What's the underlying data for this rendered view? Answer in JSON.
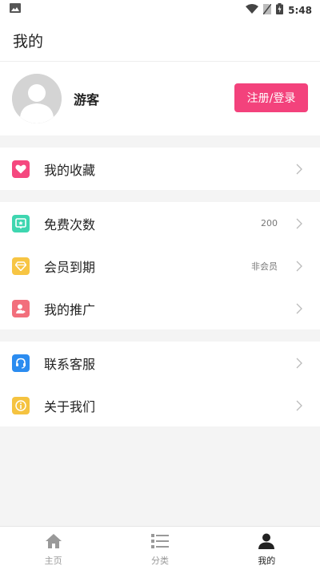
{
  "statusbar": {
    "time": "5:48"
  },
  "header": {
    "title": "我的"
  },
  "profile": {
    "name": "游客",
    "login_label": "注册/登录"
  },
  "menu": {
    "favorites": {
      "label": "我的收藏",
      "icon": "heart-icon",
      "color": "#f5487f"
    },
    "free_count": {
      "label": "免费次数",
      "value": "200",
      "icon": "ticket-icon",
      "color": "#3ed6b0"
    },
    "membership": {
      "label": "会员到期",
      "value": "非会员",
      "icon": "diamond-icon",
      "color": "#f7c543"
    },
    "promotion": {
      "label": "我的推广",
      "icon": "user-share-icon",
      "color": "#f26f7c"
    },
    "support": {
      "label": "联系客服",
      "icon": "headset-icon",
      "color": "#2b8cf0"
    },
    "about": {
      "label": "关于我们",
      "icon": "info-icon",
      "color": "#f5c340"
    }
  },
  "tabbar": {
    "home": {
      "label": "主页",
      "icon": "home-icon"
    },
    "category": {
      "label": "分类",
      "icon": "list-icon"
    },
    "mine": {
      "label": "我的",
      "icon": "person-icon"
    }
  },
  "colors": {
    "accent": "#f3427c",
    "tab_active": "#222222",
    "tab_inactive": "#999999"
  }
}
